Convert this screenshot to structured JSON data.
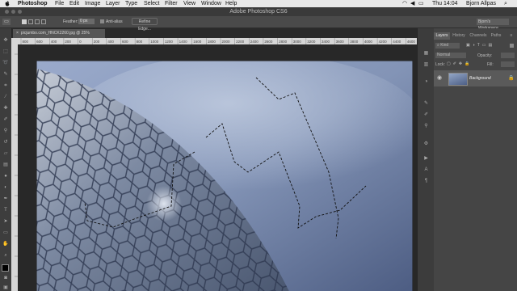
{
  "menu": {
    "app": "Photoshop",
    "items": [
      "File",
      "Edit",
      "Image",
      "Layer",
      "Type",
      "Select",
      "Filter",
      "View",
      "Window",
      "Help"
    ],
    "status": {
      "time": "Thu 14:04",
      "user": "Bjorn Allpas"
    }
  },
  "window": {
    "title": "Adobe Photoshop CS6"
  },
  "options_bar": {
    "feather_label": "Feather:",
    "feather_value": "0 px",
    "antialias_label": "Anti-alias",
    "refine_label": "Refine Edge...",
    "workspace": "Bjorn's Workspace"
  },
  "document": {
    "tab_label": "picjumbo.com_HNCK2260.jpg @ 25% (RGB/8)"
  },
  "ruler": {
    "ticks": [
      "800",
      "600",
      "400",
      "200",
      "0",
      "200",
      "400",
      "600",
      "800",
      "1000",
      "1200",
      "1400",
      "1600",
      "1800",
      "2000",
      "2200",
      "2400",
      "2600",
      "2800",
      "3000",
      "3200",
      "3400",
      "3600",
      "3800",
      "4000",
      "4200",
      "4400",
      "4600"
    ]
  },
  "layers_panel": {
    "tabs": [
      "Layers",
      "History",
      "Channels",
      "Paths"
    ],
    "filter_label": "Kind",
    "blend_mode": "Normal",
    "opacity_label": "Opacity:",
    "lock_label": "Lock:",
    "fill_label": "Fill:",
    "layer_name": "Background"
  },
  "colors": {
    "menubar": "#e8e8e8",
    "panel": "#454545",
    "toolbar": "#3d3d3d",
    "sky": "#8092b4"
  }
}
